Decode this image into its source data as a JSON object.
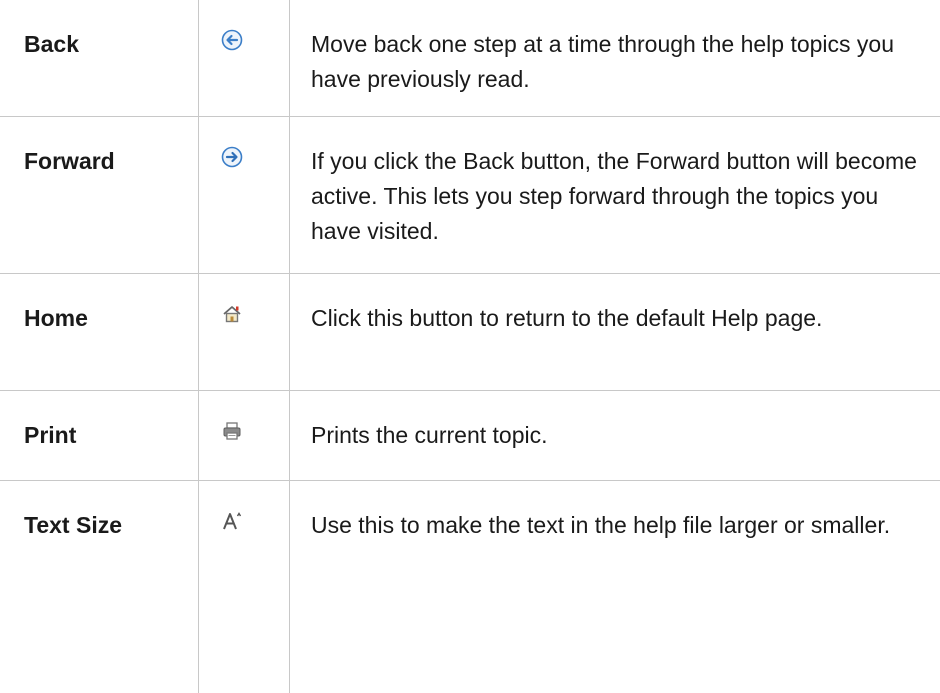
{
  "rows": [
    {
      "name": "Back",
      "icon": "back-arrow-icon",
      "description": "Move back one step at a time through the help topics you have previously read."
    },
    {
      "name": "Forward",
      "icon": "forward-arrow-icon",
      "description": "If you click the Back button, the Forward button will become active. This lets you step forward through the topics you have visited."
    },
    {
      "name": "Home",
      "icon": "home-icon",
      "description": "Click this button to return to the default Help page."
    },
    {
      "name": "Print",
      "icon": "printer-icon",
      "description": "Prints the current topic."
    },
    {
      "name": "Text Size",
      "icon": "text-size-icon",
      "description": "Use this to make the text in the help file larger or smaller."
    }
  ],
  "colors": {
    "border": "#c8c8c8",
    "arrow_blue": "#3b7ec8",
    "home_red": "#d23a2a"
  }
}
